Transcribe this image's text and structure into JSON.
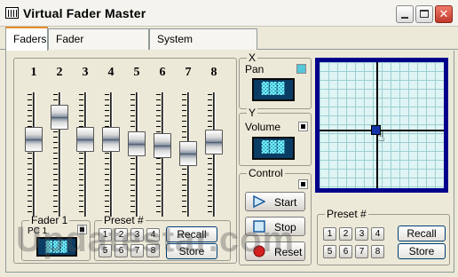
{
  "window": {
    "title": "Virtual Fader Master"
  },
  "tabs": [
    {
      "label": "Faders",
      "active": true
    },
    {
      "label": "Fader Configuration",
      "active": false
    },
    {
      "label": "System Configuration",
      "active": false
    }
  ],
  "faders": [
    {
      "number": "1",
      "level": 0.58
    },
    {
      "number": "2",
      "level": 0.8
    },
    {
      "number": "3",
      "level": 0.58
    },
    {
      "number": "4",
      "level": 0.58
    },
    {
      "number": "5",
      "level": 0.54
    },
    {
      "number": "6",
      "level": 0.52
    },
    {
      "number": "7",
      "level": 0.44
    },
    {
      "number": "8",
      "level": 0.55
    }
  ],
  "fader1": {
    "label": "Fader 1",
    "sub": "PC 1",
    "display": "▓▓▓"
  },
  "preset_left": {
    "label": "Preset #",
    "buttons": [
      "1",
      "2",
      "3",
      "4",
      "5",
      "6",
      "7",
      "8"
    ],
    "recall": "Recall",
    "store": "Store"
  },
  "x": {
    "label": "X",
    "name": "Pan",
    "display": "▓▓▓"
  },
  "y": {
    "label": "Y",
    "name": "Volume",
    "display": "▓▓▓"
  },
  "control": {
    "label": "Control",
    "start": "Start",
    "stop": "Stop",
    "reset": "Reset"
  },
  "preset_right": {
    "label": "Preset #",
    "buttons": [
      "1",
      "2",
      "3",
      "4",
      "5",
      "6",
      "7",
      "8"
    ],
    "recall": "Recall",
    "store": "Store"
  },
  "watermark": "Updatestar.com",
  "colors": {
    "lcd_bg": "#0a3c64",
    "lcd_fg": "#6ff3ff",
    "xy_border": "#00008b",
    "xy_bg": "#dff4f4"
  }
}
